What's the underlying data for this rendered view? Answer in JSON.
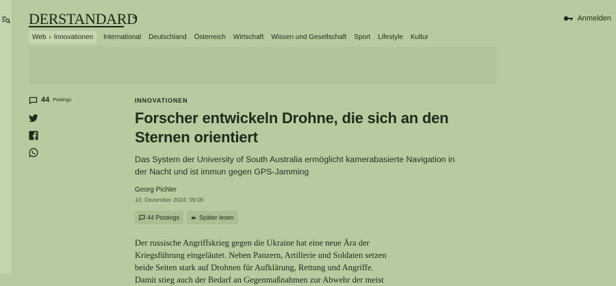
{
  "site": {
    "logo_text": "DERSTANDARD"
  },
  "header": {
    "login_label": "Anmelden"
  },
  "breadcrumb": {
    "parent": "Web",
    "separator": "›",
    "current": "Innovationen"
  },
  "nav": {
    "items": [
      "International",
      "Deutschland",
      "Österreich",
      "Wirtschaft",
      "Wissen und Gesellschaft",
      "Sport",
      "Lifestyle",
      "Kultur"
    ]
  },
  "share": {
    "postings_count": "44",
    "postings_label": "Postings"
  },
  "article": {
    "kicker": "INNOVATIONEN",
    "headline": "Forscher entwickeln Drohne, die sich an den Sternen orientiert",
    "subhead": "Das System der University of South Australia ermöglicht kamerabasierte Navigation in der Nacht und ist immun gegen GPS-Jamming",
    "author": "Georg Pichler",
    "date": "10. Dezember 2024, 09:00",
    "postings_button": "44 Postings",
    "read_later_button": "Später lesen",
    "body": "Der russische Angriffskrieg gegen die Ukraine hat eine neue Ära der Kriegsführung eingeläutet. Neben Panzern, Artillerie und Soldaten setzen beide Seiten stark auf Drohnen für Aufklärung, Rettung und Angriffe. Damit stieg auch der Bedarf an Gegenmaßnahmen zur Abwehr der meist"
  },
  "colors": {
    "page_background": "#b7cba0",
    "ad_slot": "#afc498",
    "button_bg": "#a9bf93"
  },
  "icons": [
    "menu-search-icon",
    "chevron-down-icon",
    "key-icon",
    "comment-icon",
    "twitter-icon",
    "facebook-icon",
    "whatsapp-icon",
    "bookmark-icon"
  ]
}
